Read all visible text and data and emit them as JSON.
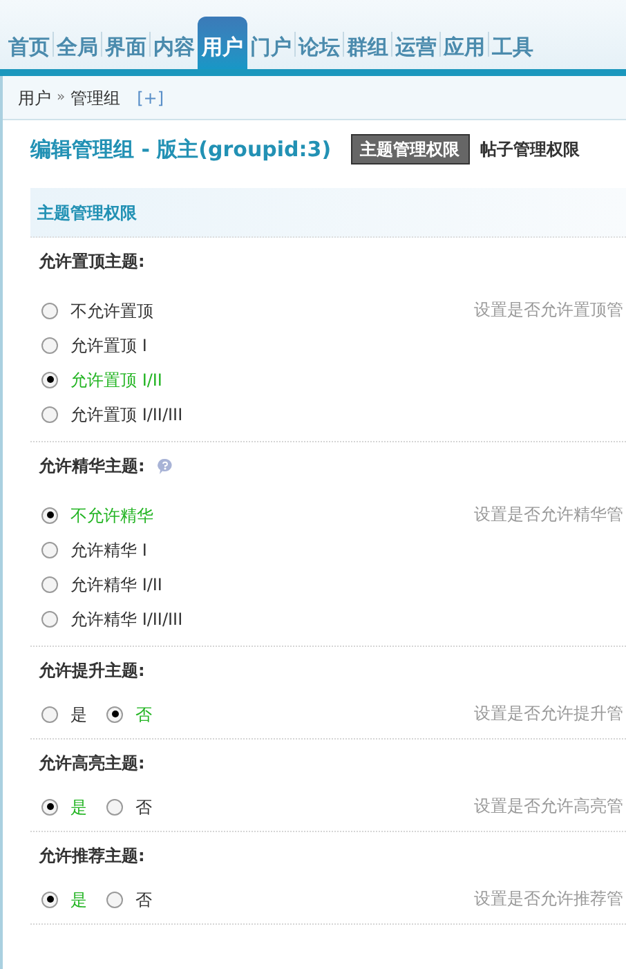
{
  "nav": {
    "tabs": [
      {
        "label": "首页",
        "selected": false
      },
      {
        "label": "全局",
        "selected": false
      },
      {
        "label": "界面",
        "selected": false
      },
      {
        "label": "内容",
        "selected": false
      },
      {
        "label": "用户",
        "selected": true
      },
      {
        "label": "门户",
        "selected": false
      },
      {
        "label": "论坛",
        "selected": false
      },
      {
        "label": "群组",
        "selected": false
      },
      {
        "label": "运营",
        "selected": false
      },
      {
        "label": "应用",
        "selected": false
      },
      {
        "label": "工具",
        "selected": false
      }
    ]
  },
  "breadcrumb": {
    "items": [
      "用户",
      "管理组"
    ],
    "separator": "»",
    "add": "[+]"
  },
  "title": "编辑管理组 - 版主(groupid:3)",
  "subtabs": [
    {
      "label": "主题管理权限",
      "selected": true
    },
    {
      "label": "帖子管理权限",
      "selected": false
    }
  ],
  "section": {
    "title": "主题管理权限"
  },
  "settings": [
    {
      "label": "允许置顶主题:",
      "help": false,
      "kind": "list",
      "hint": "设置是否允许置顶管",
      "options": [
        {
          "label": "不允许置顶",
          "selected": false
        },
        {
          "label": "允许置顶 I",
          "selected": false
        },
        {
          "label": "允许置顶 I/II",
          "selected": true
        },
        {
          "label": "允许置顶 I/II/III",
          "selected": false
        }
      ]
    },
    {
      "label": "允许精华主题:",
      "help": true,
      "kind": "list",
      "hint": "设置是否允许精华管",
      "options": [
        {
          "label": "不允许精华",
          "selected": true
        },
        {
          "label": "允许精华 I",
          "selected": false
        },
        {
          "label": "允许精华 I/II",
          "selected": false
        },
        {
          "label": "允许精华 I/II/III",
          "selected": false
        }
      ]
    },
    {
      "label": "允许提升主题:",
      "help": false,
      "kind": "inline",
      "hint": "设置是否允许提升管",
      "options": [
        {
          "label": "是",
          "selected": false
        },
        {
          "label": "否",
          "selected": true
        }
      ]
    },
    {
      "label": "允许高亮主题:",
      "help": false,
      "kind": "inline",
      "hint": "设置是否允许高亮管",
      "options": [
        {
          "label": "是",
          "selected": true
        },
        {
          "label": "否",
          "selected": false
        }
      ]
    },
    {
      "label": "允许推荐主题:",
      "help": false,
      "kind": "inline",
      "hint": "设置是否允许推荐管",
      "options": [
        {
          "label": "是",
          "selected": true
        },
        {
          "label": "否",
          "selected": false
        }
      ]
    }
  ]
}
